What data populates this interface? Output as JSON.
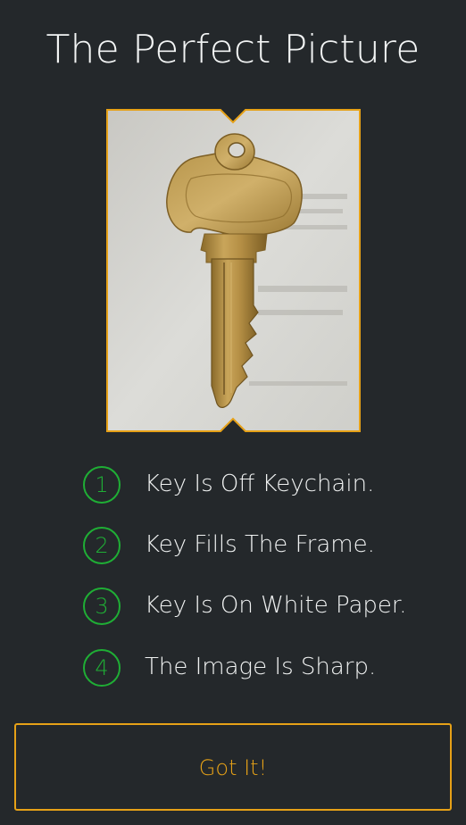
{
  "header": {
    "title": "The Perfect Picture"
  },
  "photo": {
    "subject": "key-photo",
    "frame_color": "#e6a117"
  },
  "checklist": [
    {
      "number": "1",
      "text": "Key Is Off Keychain."
    },
    {
      "number": "2",
      "text": "Key Fills The Frame."
    },
    {
      "number": "3",
      "text": "Key Is On White Paper."
    },
    {
      "number": "4",
      "text": "The Image Is Sharp."
    }
  ],
  "actions": {
    "confirm_label": "Got It!"
  },
  "colors": {
    "background": "#24282b",
    "accent": "#e6a117",
    "check_green": "#1fae35",
    "text": "#f0f2f2"
  }
}
